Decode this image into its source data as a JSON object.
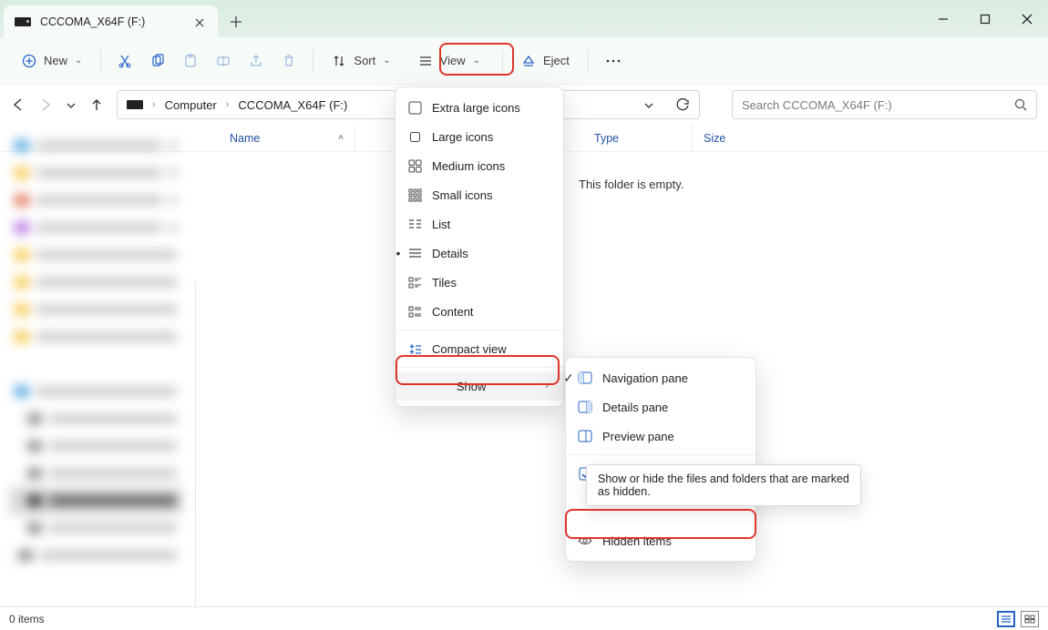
{
  "window": {
    "tab_title": "CCCOMA_X64F (F:)",
    "status": "0 items"
  },
  "toolbar": {
    "new": "New",
    "sort": "Sort",
    "view": "View",
    "eject": "Eject"
  },
  "breadcrumb": {
    "root": "Computer",
    "current": "CCCOMA_X64F (F:)"
  },
  "search": {
    "placeholder": "Search CCCOMA_X64F (F:)"
  },
  "columns": {
    "name": "Name",
    "type": "Type",
    "size": "Size"
  },
  "main": {
    "empty": "This folder is empty."
  },
  "view_menu": {
    "xl": "Extra large icons",
    "lg": "Large icons",
    "md": "Medium icons",
    "sm": "Small icons",
    "list": "List",
    "details": "Details",
    "tiles": "Tiles",
    "content": "Content",
    "compact": "Compact view",
    "show": "Show"
  },
  "show_menu": {
    "nav": "Navigation pane",
    "details": "Details pane",
    "preview": "Preview pane",
    "checkboxes": "Item check boxes",
    "hidden": "Hidden items"
  },
  "tooltip": {
    "hidden": "Show or hide the files and folders that are marked as hidden."
  }
}
